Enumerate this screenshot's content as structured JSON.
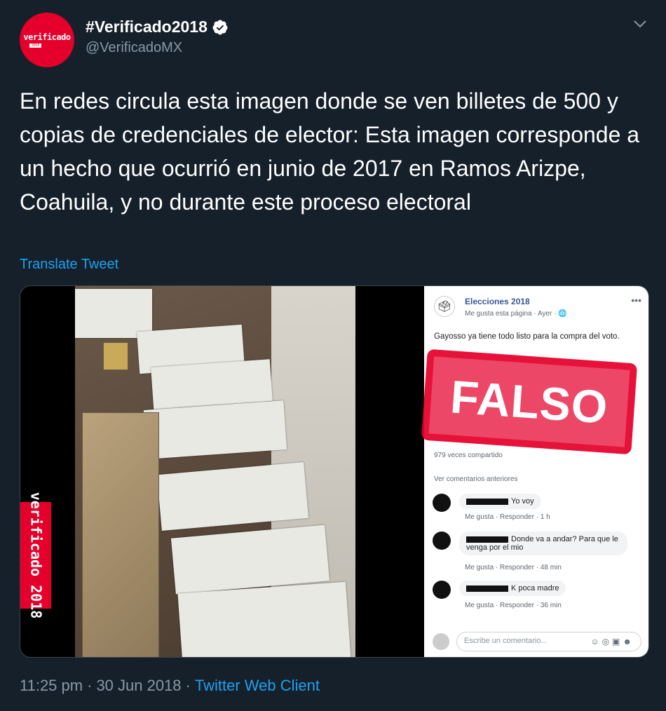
{
  "author": {
    "name": "#Verificado2018",
    "handle": "@VerificadoMX",
    "avatar_wordmark": "verificado",
    "avatar_year": "2018"
  },
  "tweet": {
    "text": "En redes circula esta imagen donde se ven billetes de 500 y copias de credenciales de elector: Esta imagen corresponde a un hecho que ocurrió en junio de 2017 en Ramos Arizpe, Coahuila, y no durante este proceso electoral",
    "translate_label": "Translate Tweet"
  },
  "media": {
    "badge_text": "verificado 2018",
    "stamp_text": "FALSO",
    "fb_page_title": "Elecciones 2018",
    "fb_page_subtitle": "Me gusta esta página · Ayer · ",
    "fb_post_text": "Gayosso ya tiene todo listo para la compra del voto.",
    "fb_shared": "979 veces compartido",
    "fb_more_comments": "Ver comentarios anteriores",
    "comments": [
      {
        "text": "Yo voy",
        "meta": "Me gusta · Responder · 1 h"
      },
      {
        "text": "Donde va a andar? Para que le venga por el mio",
        "meta": "Me gusta · Responder · 48 min"
      },
      {
        "text": "K poca madre",
        "meta": "Me gusta · Responder · 36 min"
      }
    ],
    "fb_input_placeholder": "Escribe un comentario..."
  },
  "footer": {
    "time": "11:25 pm",
    "sep1": "·",
    "date": "30 Jun 2018",
    "sep2": "·",
    "client": "Twitter Web Client"
  },
  "colors": {
    "background": "#15202b",
    "link": "#1da1f2",
    "muted": "#8899a6",
    "brand_red": "#e4002b"
  }
}
